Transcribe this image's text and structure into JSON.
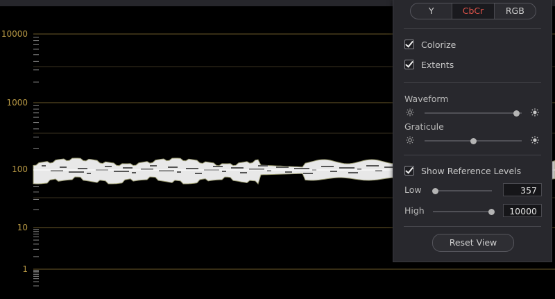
{
  "scale": {
    "labels": [
      "10000",
      "1000",
      "100",
      "10",
      "1"
    ],
    "label_color": "#b79844",
    "gridline_color": "#6b5a2a"
  },
  "panel": {
    "segmented": {
      "options": [
        "Y",
        "CbCr",
        "RGB"
      ],
      "selected": "CbCr",
      "active_color": "#e0544a"
    },
    "colorize": {
      "label": "Colorize",
      "checked": true
    },
    "extents": {
      "label": "Extents",
      "checked": true
    },
    "waveform": {
      "label": "Waveform",
      "level": 0.94
    },
    "graticule": {
      "label": "Graticule",
      "level": 0.5
    },
    "show_reference_levels": {
      "label": "Show Reference Levels",
      "checked": true
    },
    "low": {
      "label": "Low",
      "value": "357",
      "level": 0.0
    },
    "high": {
      "label": "High",
      "value": "10000",
      "level": 1.0
    },
    "reset_label": "Reset View"
  },
  "icons": {
    "brightness_low": "sun-outline-icon",
    "brightness_high": "sun-filled-icon"
  }
}
